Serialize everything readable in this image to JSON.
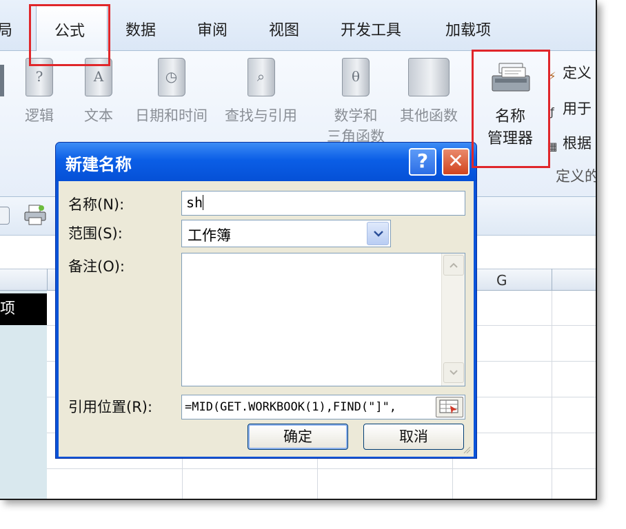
{
  "ribbon": {
    "tabs": [
      {
        "label": "局"
      },
      {
        "label": "公式"
      },
      {
        "label": "数据"
      },
      {
        "label": "审阅"
      },
      {
        "label": "视图"
      },
      {
        "label": "开发工具"
      },
      {
        "label": "加载项"
      }
    ],
    "buttons": [
      {
        "label": "逻辑",
        "icon": "question-mark-book-icon"
      },
      {
        "label": "文本",
        "icon": "text-book-icon"
      },
      {
        "label": "日期和时间",
        "icon": "calendar-book-icon"
      },
      {
        "label": "查找与引用",
        "icon": "magnifier-book-icon"
      },
      {
        "label": "数学和",
        "label2": "三角函数",
        "icon": "theta-book-icon"
      },
      {
        "label": "其他函数",
        "icon": "books-icon"
      }
    ],
    "name_manager": {
      "line1": "名称",
      "line2": "管理器"
    },
    "defined_names": [
      {
        "label": "定义",
        "icon": "define-name-icon"
      },
      {
        "label": "用于",
        "icon": "use-in-formula-icon"
      },
      {
        "label": "根据",
        "icon": "create-from-selection-icon"
      }
    ],
    "group_label": "定义的"
  },
  "sheet": {
    "column_g": "G",
    "black_cell_text": "项"
  },
  "dialog": {
    "title": "新建名称",
    "help": "?",
    "close": "✕",
    "name_label": "名称(N):",
    "name_value": "sh",
    "scope_label": "范围(S):",
    "scope_value": "工作簿",
    "comment_label": "备注(O):",
    "comment_value": "",
    "ref_label": "引用位置(R):",
    "ref_value": "=MID(GET.WORKBOOK(1),FIND(\"]\",",
    "ok": "确定",
    "cancel": "取消"
  },
  "colors": {
    "highlight": "#e0262a",
    "dialog_title": "#0b5ee6",
    "dialog_body": "#ece9d8"
  }
}
